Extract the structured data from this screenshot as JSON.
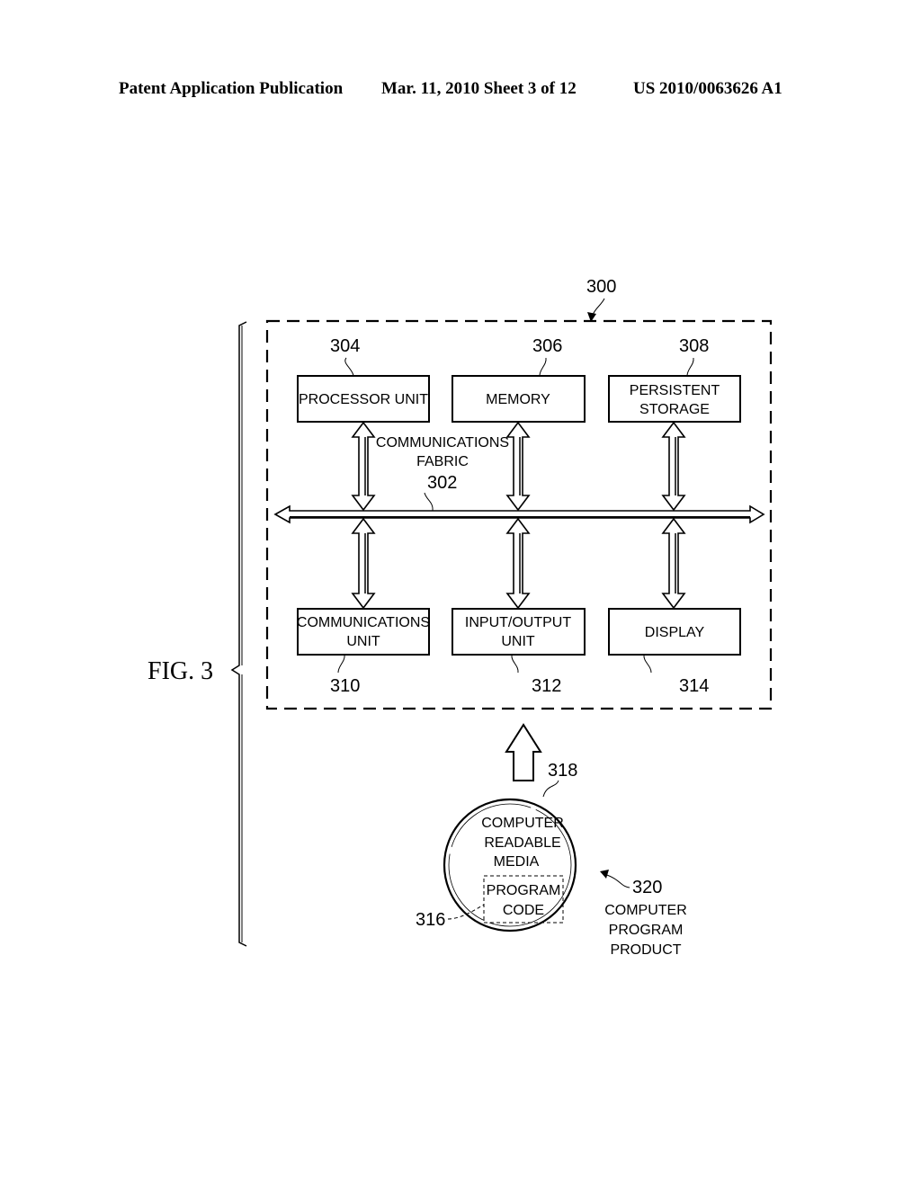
{
  "header": {
    "publication": "Patent Application Publication",
    "date_sheet": "Mar. 11, 2010  Sheet 3 of 12",
    "patent_number": "US 2010/0063626 A1"
  },
  "figure": {
    "label": "FIG. 3",
    "system_ref": "300",
    "fabric": {
      "line1": "COMMUNICATIONS",
      "line2": "FABRIC",
      "ref": "302"
    },
    "top_blocks": [
      {
        "ref": "304",
        "lines": [
          "PROCESSOR UNIT"
        ]
      },
      {
        "ref": "306",
        "lines": [
          "MEMORY"
        ]
      },
      {
        "ref": "308",
        "lines": [
          "PERSISTENT",
          "STORAGE"
        ]
      }
    ],
    "bottom_blocks": [
      {
        "ref": "310",
        "lines": [
          "COMMUNICATIONS",
          "UNIT"
        ]
      },
      {
        "ref": "312",
        "lines": [
          "INPUT/OUTPUT",
          "UNIT"
        ]
      },
      {
        "ref": "314",
        "lines": [
          "DISPLAY"
        ]
      }
    ],
    "media": {
      "ref": "318",
      "lines": [
        "COMPUTER",
        "READABLE",
        "MEDIA"
      ],
      "program_code": {
        "ref": "316",
        "lines": [
          "PROGRAM",
          "CODE"
        ]
      }
    },
    "product": {
      "ref": "320",
      "lines": [
        "COMPUTER",
        "PROGRAM",
        "PRODUCT"
      ]
    }
  }
}
